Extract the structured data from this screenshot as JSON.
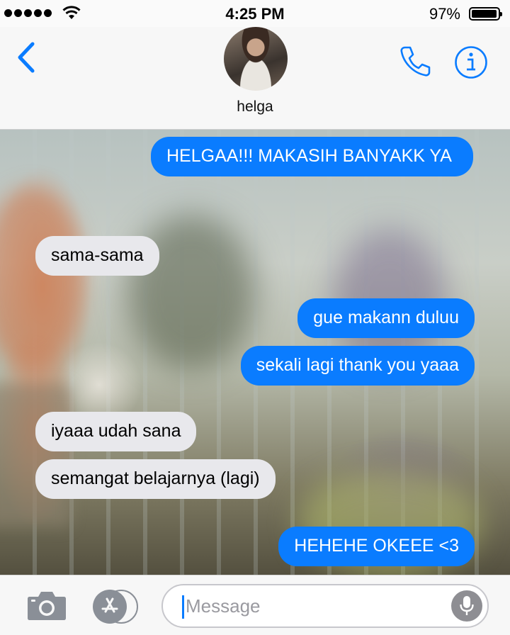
{
  "status_bar": {
    "time": "4:25 PM",
    "battery_percent": "97%",
    "battery_level": 0.97,
    "signal_bars": 5,
    "icons": [
      "signal-dots-icon",
      "wifi-icon",
      "battery-icon"
    ]
  },
  "header": {
    "back_icon": "chevron-left-icon",
    "contact_name": "helga",
    "call_icon": "phone-icon",
    "info_icon": "info-icon"
  },
  "messages": [
    {
      "direction": "outgoing",
      "text": "HELGAA!!! MAKASIH BANYAKK YA"
    },
    {
      "direction": "incoming",
      "text": "sama-sama"
    },
    {
      "direction": "outgoing",
      "text": "gue makann duluu"
    },
    {
      "direction": "outgoing",
      "text": "sekali lagi thank you yaaa"
    },
    {
      "direction": "incoming",
      "text": "iyaaa udah sana"
    },
    {
      "direction": "incoming",
      "text": "semangat belajarnya (lagi)"
    },
    {
      "direction": "outgoing",
      "text": "HEHEHE OKEEE <3"
    }
  ],
  "composer": {
    "placeholder": "Message",
    "camera_icon": "camera-icon",
    "apps_icon": "app-store-icon",
    "mic_icon": "microphone-icon"
  },
  "colors": {
    "accent": "#0a7cff",
    "outgoing_bubble": "#0a7cff",
    "incoming_bubble": "#e8e8ec",
    "bar_background": "#f7f7f7"
  }
}
